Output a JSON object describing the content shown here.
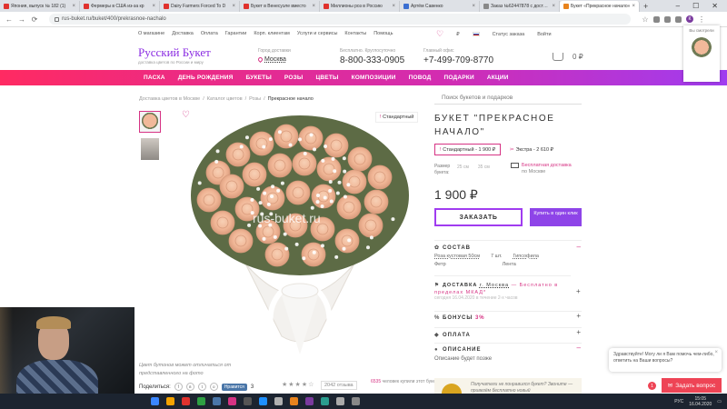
{
  "browser": {
    "tabs": [
      {
        "title": "Япония, выпуск № 182 (1)",
        "color": "red"
      },
      {
        "title": "Фермеры в США из-за кр",
        "color": "red"
      },
      {
        "title": "Dairy Farmers Forced To D",
        "color": "red"
      },
      {
        "title": "Букет в Венесуэле вместо",
        "color": "red"
      },
      {
        "title": "Миллионы роз в Россию",
        "color": "red"
      },
      {
        "title": "Артём Савенко",
        "color": "blue"
      },
      {
        "title": "Заказ №62447878 с доставкой",
        "color": "gray"
      },
      {
        "title": "Букет «Прекрасное начало»",
        "color": "orange",
        "active": true
      }
    ],
    "url": "rus-buket.ru/buket/400/prekrasnoe-nachalo",
    "profile_initial": "К"
  },
  "site": {
    "toplinks": [
      "О магазине",
      "Доставка",
      "Оплата",
      "Гарантии",
      "Корп. клиентам",
      "Услуги и сервисы",
      "Контакты",
      "Помощь"
    ],
    "currency": "₽",
    "order_status": "Статус заказа",
    "login": "Войти",
    "logo": "Русский Букет",
    "logo_sub": "доставка цветов по России и миру",
    "city_label": "Город доставки",
    "city": "Москва",
    "phone1_label": "Бесплатно. Круглосуточно",
    "phone1": "8-800-333-0905",
    "phone2_label": "Главный офис",
    "phone2": "+7-499-709-8770",
    "cart_total": "0 ₽",
    "menu": [
      "ПАСХА",
      "ДЕНЬ РОЖДЕНИЯ",
      "БУКЕТЫ",
      "РОЗЫ",
      "ЦВЕТЫ",
      "КОМПОЗИЦИИ",
      "ПОВОД",
      "ПОДАРКИ",
      "АКЦИИ"
    ]
  },
  "breadcrumb": {
    "items": [
      "Доставка цветов в Москве",
      "Каталог цветов",
      "Розы"
    ],
    "separator": "/",
    "current": "Прекрасное начало"
  },
  "product": {
    "badge": "Стандартный",
    "watermark": "rus-buket.ru",
    "note": "Цвет бутонов может отличаться от представленного на фото",
    "share_label": "Поделиться:",
    "vk_label": "Нравится",
    "vk_count": "3",
    "rating_stars": "★★★★☆",
    "rating_value": 4,
    "reviews": "2042 отзыва",
    "buyers_count": "6535",
    "buyers_text": "человек купили этот букет",
    "search_placeholder": "Поиск букетов и подарков",
    "title": "БУКЕТ \"ПРЕКРАСНОЕ НАЧАЛО\"",
    "size_standard": "Стандартный - 1 900 ₽",
    "size_extra": "Экстра - 2 610 ₽",
    "size_label": "Размер букета:",
    "size_w": "25 см",
    "size_h": "35 см",
    "free_delivery": "Бесплатная доставка",
    "free_delivery_sub": "по Москве",
    "price": "1 900 ₽",
    "order_button": "ЗАКАЗАТЬ",
    "one_click_button": "Купить в один клик"
  },
  "sections": {
    "composition": "СОСТАВ",
    "comp_item1": "Роза кустовая 50см",
    "comp_qty": "7 шт.",
    "comp_item2": "Гипсофила",
    "comp_item3": "Фетр",
    "comp_item4": "Лента",
    "delivery": "ДОСТАВКА",
    "delivery_city": "г. Москва",
    "delivery_free": "— Бесплатно в пределах МКАД*",
    "delivery_sub": "сегодня 16.04.2020 в течение 2-х часов",
    "bonuses": "БОНУСЫ",
    "bonuses_pct": "3%",
    "payment": "ОПЛАТА",
    "description": "ОПИСАНИЕ",
    "description_text": "Описание будет позже",
    "promo": "Получатели не понравился букет? Звоните — привезём бесплатно новый"
  },
  "popup": {
    "label": "Вы смотрели"
  },
  "chat": {
    "bubble": "Здравствуйте! Могу ли я Вам помочь чем-либо, ответить на Ваши вопросы?",
    "badge": "1",
    "button": "Задать вопрос"
  },
  "taskbar": {
    "lang": "РУС",
    "time": "15:05",
    "date": "16.04.2020"
  },
  "colors": {
    "accent_pink": "#d63384",
    "accent_purple": "#8e44e8",
    "menu_gradient_start": "#ff2a62",
    "menu_gradient_end": "#a03cf0"
  }
}
